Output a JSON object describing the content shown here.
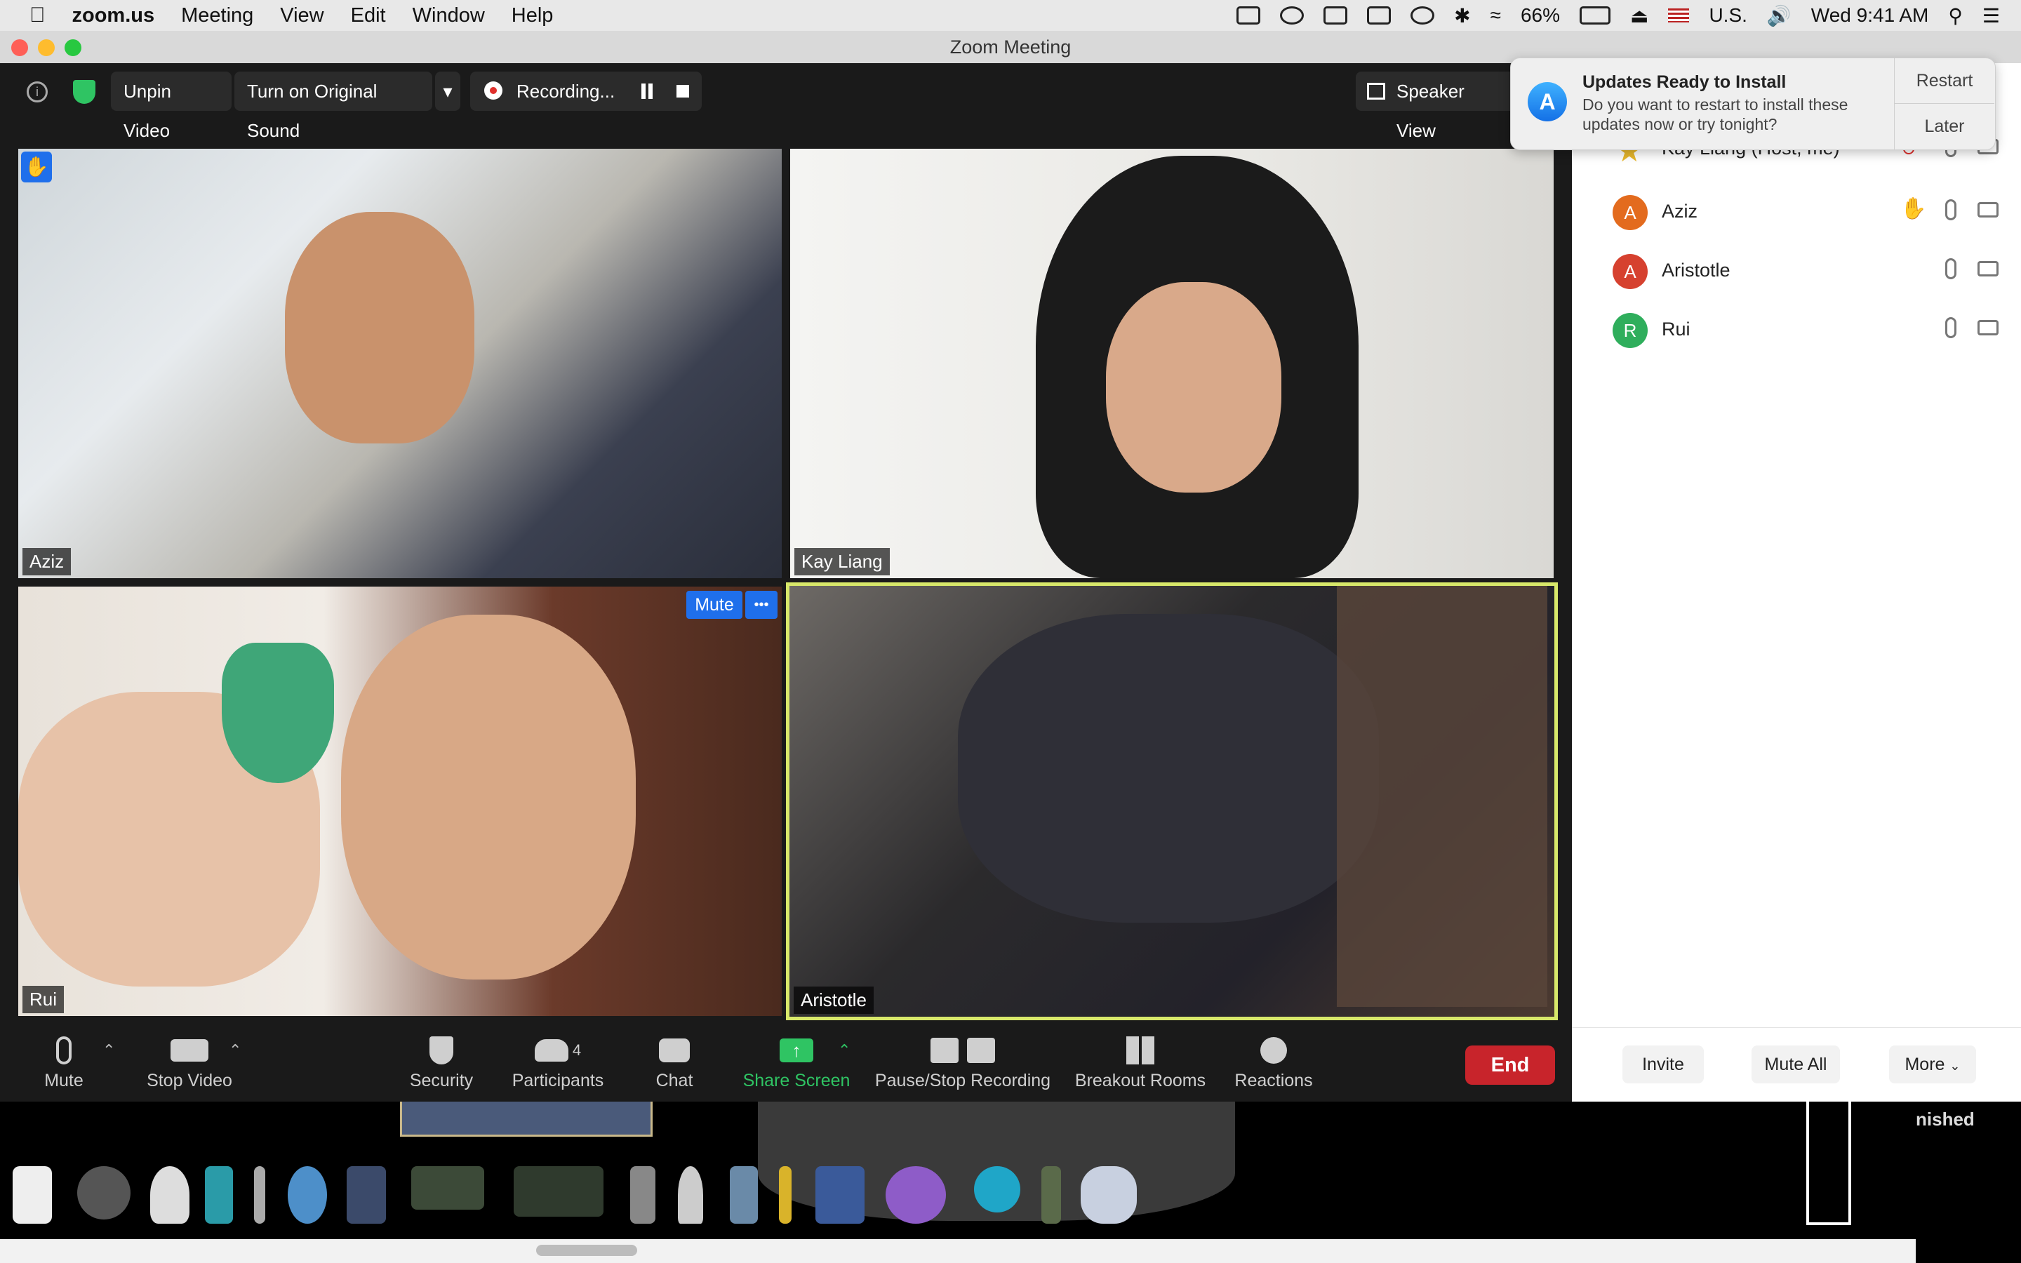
{
  "menubar": {
    "app_name": "zoom.us",
    "menus": [
      "Meeting",
      "View",
      "Edit",
      "Window",
      "Help"
    ],
    "battery": "66%",
    "input_source": "U.S.",
    "clock": "Wed 9:41 AM"
  },
  "window": {
    "title": "Zoom Meeting"
  },
  "topbar": {
    "unpin_label": "Unpin Video",
    "original_sound_label": "Turn on Original Sound",
    "recording_label": "Recording...",
    "speaker_view_label": "Speaker View"
  },
  "tiles": [
    {
      "name": "Aziz"
    },
    {
      "name": "Kay Liang"
    },
    {
      "name": "Rui"
    },
    {
      "name": "Aristotle"
    }
  ],
  "tile_overlay": {
    "mute_label": "Mute",
    "more_label": "•••"
  },
  "controls": {
    "mute": "Mute",
    "stop_video": "Stop Video",
    "security": "Security",
    "participants": "Participants",
    "participants_count": "4",
    "chat": "Chat",
    "share_screen": "Share Screen",
    "pause_stop_recording": "Pause/Stop Recording",
    "breakout_rooms": "Breakout Rooms",
    "reactions": "Reactions",
    "end": "End"
  },
  "participants": [
    {
      "initial": "",
      "name": "Kay Liang (Host, me)",
      "color": "#e8b82c"
    },
    {
      "initial": "A",
      "name": "Aziz",
      "color": "#e36b1e"
    },
    {
      "initial": "A",
      "name": "Aristotle",
      "color": "#d6412f"
    },
    {
      "initial": "R",
      "name": "Rui",
      "color": "#2fae5c"
    }
  ],
  "participants_footer": {
    "invite": "Invite",
    "mute_all": "Mute All",
    "more": "More"
  },
  "notification": {
    "title": "Updates Ready to Install",
    "body": "Do you want to restart to install these updates now or try tonight?",
    "restart": "Restart",
    "later": "Later"
  },
  "desktop_fragment": "nished",
  "colors": {
    "end_red": "#c8242b",
    "share_green": "#2fc463",
    "raise_hand_blue": "#1f6feb",
    "active_speaker_border": "#d8e86a"
  }
}
